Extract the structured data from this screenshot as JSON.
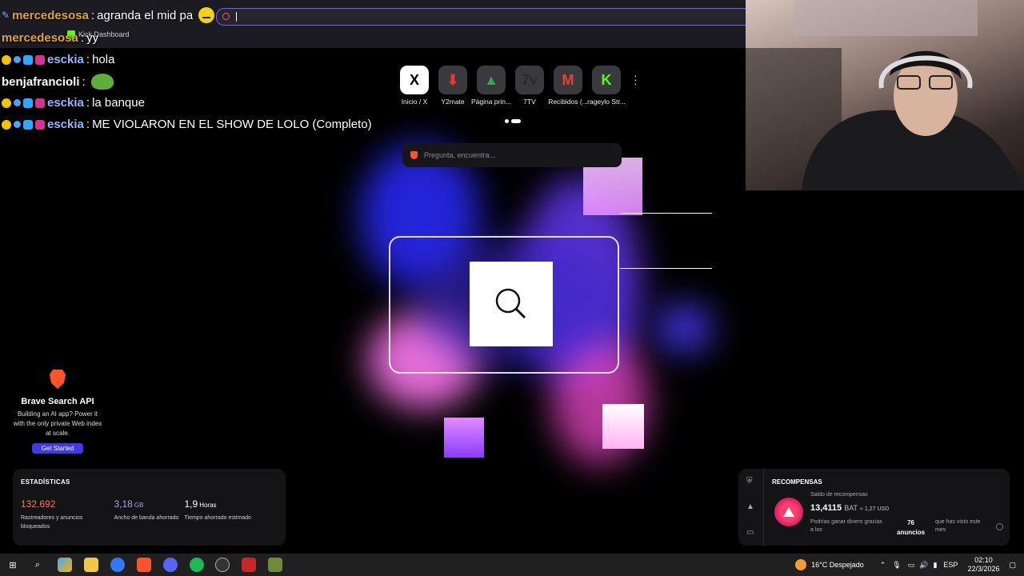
{
  "chat": {
    "line1": {
      "user": "mercedesosa",
      "text": "agranda el mid pa"
    },
    "line2": {
      "user": "mercedesosa",
      "text": "yy"
    },
    "line3": {
      "user": "esckia",
      "text": "hola"
    },
    "line4": {
      "user": "benjafrancioli",
      "text": ""
    },
    "line5": {
      "user": "esckia",
      "text": "la banque"
    },
    "line6": {
      "user": "esckia",
      "text": "ME VIOLARON EN EL SHOW DE LOLO (Completo)"
    }
  },
  "bookmarks": [
    {
      "label": "Kick Dashboard"
    }
  ],
  "topsites": [
    {
      "label": "Inicio / X",
      "glyph": "X",
      "icon": "x-icon",
      "color": "#000000"
    },
    {
      "label": "Y2mate",
      "glyph": "⬇",
      "icon": "y2mate-icon",
      "color": "#e53935"
    },
    {
      "label": "Página prin...",
      "glyph": "▲",
      "icon": "google-drive-icon",
      "color": "#34a853"
    },
    {
      "label": "7TV",
      "glyph": "7v",
      "icon": "7tv-icon",
      "color": "#2b2b2b"
    },
    {
      "label": "Recibidos (...",
      "glyph": "M",
      "icon": "gmail-icon",
      "color": "#ea4335"
    },
    {
      "label": "rageylo Str...",
      "glyph": "K",
      "icon": "kick-icon",
      "color": "#53fc18"
    }
  ],
  "ntp_search": {
    "placeholder": "Pregunta, encuentra..."
  },
  "api_card": {
    "title": "Brave Search API",
    "description": "Building an AI app? Power it with the only private Web index at scale.",
    "button": "Get Started"
  },
  "stats": {
    "title": "ESTADÍSTICAS",
    "items": [
      {
        "value": "132.692",
        "unit": "",
        "label": "Rastreadores y anuncios bloqueados",
        "color": "#ff7654"
      },
      {
        "value": "3,18",
        "unit": "GB",
        "label": "Ancho de banda ahorrado",
        "color": "#a0a5eb"
      },
      {
        "value": "1,9",
        "unit": "Horas",
        "label": "Tiempo ahorrado estimado",
        "color": "#ffffff"
      }
    ]
  },
  "rewards": {
    "title": "RECOMPENSAS",
    "balance_label": "Saldo de recompensas",
    "balance": "13,4115",
    "currency": "BAT",
    "usd": "≈ 1,27 USD",
    "earn_text": "Podrías ganar dinero gracias a los",
    "ads_count": "76",
    "ads_label": "anuncios",
    "seen_text": "que has visto este mes"
  },
  "taskbar": {
    "weather": "16°C Despejado",
    "lang": "ESP",
    "time": "02:10",
    "date": "22/3/2026"
  }
}
